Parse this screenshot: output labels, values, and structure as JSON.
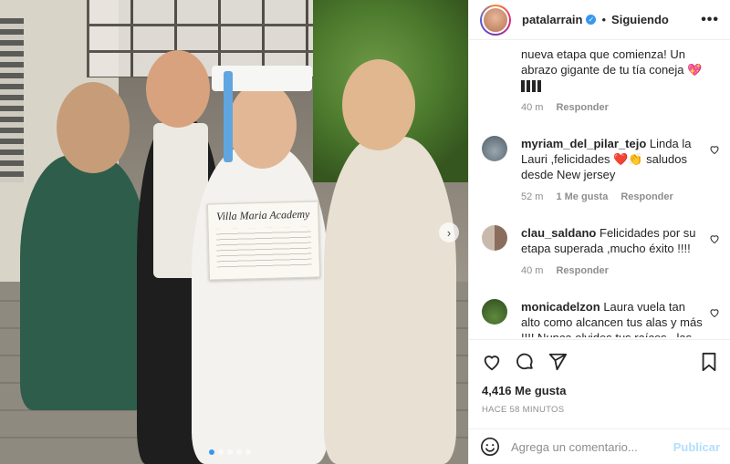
{
  "post": {
    "photo_alt": "",
    "diploma_text": "Villa Maria Academy",
    "carousel": {
      "total": 5,
      "active": 1
    }
  },
  "header": {
    "username": "patalarrain",
    "separator": "•",
    "follow_label": "Siguiendo",
    "more_label": "•••"
  },
  "comments": {
    "caption_tail": "nueva etapa que comienza! Un abrazo gigante de tu tía coneja 💖",
    "caption_meta": {
      "time": "40 m",
      "reply": "Responder"
    },
    "items": [
      {
        "user": "myriam_del_pilar_tejo",
        "text": "Linda la Lauri ,felicidades ❤️👏 saludos desde New jersey",
        "time": "52 m",
        "likes": "1 Me gusta",
        "reply": "Responder"
      },
      {
        "user": "clau_saldano",
        "text": "Felicidades por su etapa superada ,mucho éxito !!!!",
        "time": "40 m",
        "reply": "Responder"
      },
      {
        "user": "monicadelzon",
        "text": "Laura vuela tan alto como alcancen tus alas y más !!!! Nunca olvides tus raíces , las que impulsaron a ese vuelo con tanto"
      }
    ]
  },
  "actions": {
    "likes": "4,416 Me gusta",
    "timestamp": "HACE 58 MINUTOS"
  },
  "composer": {
    "placeholder": "Agrega un comentario...",
    "publish_label": "Publicar"
  },
  "colors": {
    "accent": "#3897f0",
    "publish_disabled": "#b2dffc",
    "muted": "#8e8e8e"
  }
}
